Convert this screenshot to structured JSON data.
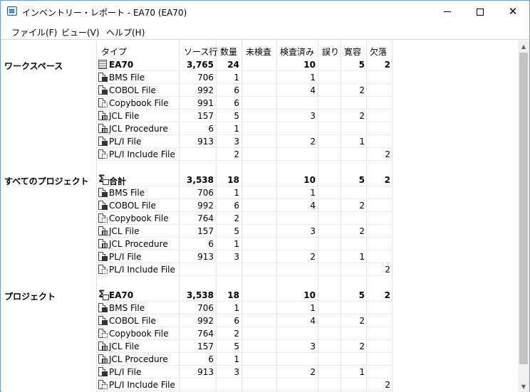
{
  "window": {
    "title": "インベントリー・レポート - EA70 (EA70)",
    "controls": {
      "minimize": "—",
      "maximize": "☐",
      "close": "✕"
    }
  },
  "menu": [
    {
      "label": "ファイル(F)"
    },
    {
      "label": "ビュー(V)"
    },
    {
      "label": "ヘルプ(H)"
    }
  ],
  "columns": {
    "type": "タイプ",
    "source_lines": "ソース行",
    "count": "数量",
    "unchecked": "未検査",
    "checked": "検査済み",
    "errors": "誤り",
    "tolerated": "寛容",
    "missing": "欠落"
  },
  "sections": [
    {
      "label": "ワークスペース",
      "summary": {
        "icon": "workspace-icon",
        "type": "EA70",
        "source_lines": "3,765",
        "count": "24",
        "unchecked": "",
        "checked": "10",
        "errors": "",
        "tolerated": "5",
        "missing": "2"
      },
      "rows": [
        {
          "icon": "bms-file-icon",
          "type": "BMS File",
          "source_lines": "706",
          "count": "1",
          "unchecked": "",
          "checked": "1",
          "errors": "",
          "tolerated": "",
          "missing": ""
        },
        {
          "icon": "cobol-file-icon",
          "type": "COBOL File",
          "source_lines": "992",
          "count": "6",
          "unchecked": "",
          "checked": "4",
          "errors": "",
          "tolerated": "2",
          "missing": ""
        },
        {
          "icon": "copybook-file-icon",
          "type": "Copybook File",
          "source_lines": "991",
          "count": "6",
          "unchecked": "",
          "checked": "",
          "errors": "",
          "tolerated": "",
          "missing": ""
        },
        {
          "icon": "jcl-file-icon",
          "type": "JCL File",
          "source_lines": "157",
          "count": "5",
          "unchecked": "",
          "checked": "3",
          "errors": "",
          "tolerated": "2",
          "missing": ""
        },
        {
          "icon": "jcl-procedure-icon",
          "type": "JCL Procedure",
          "source_lines": "6",
          "count": "1",
          "unchecked": "",
          "checked": "",
          "errors": "",
          "tolerated": "",
          "missing": ""
        },
        {
          "icon": "pli-file-icon",
          "type": "PL/I File",
          "source_lines": "913",
          "count": "3",
          "unchecked": "",
          "checked": "2",
          "errors": "",
          "tolerated": "1",
          "missing": ""
        },
        {
          "icon": "pli-include-file-icon",
          "type": "PL/I Include File",
          "source_lines": "",
          "count": "2",
          "unchecked": "",
          "checked": "",
          "errors": "",
          "tolerated": "",
          "missing": "2"
        }
      ]
    },
    {
      "label": "すべてのプロジェクト",
      "summary": {
        "icon": "total-icon",
        "type": "合計",
        "source_lines": "3,538",
        "count": "18",
        "unchecked": "",
        "checked": "10",
        "errors": "",
        "tolerated": "5",
        "missing": "2"
      },
      "rows": [
        {
          "icon": "bms-file-icon",
          "type": "BMS File",
          "source_lines": "706",
          "count": "1",
          "unchecked": "",
          "checked": "1",
          "errors": "",
          "tolerated": "",
          "missing": ""
        },
        {
          "icon": "cobol-file-icon",
          "type": "COBOL File",
          "source_lines": "992",
          "count": "6",
          "unchecked": "",
          "checked": "4",
          "errors": "",
          "tolerated": "2",
          "missing": ""
        },
        {
          "icon": "copybook-file-icon",
          "type": "Copybook File",
          "source_lines": "764",
          "count": "2",
          "unchecked": "",
          "checked": "",
          "errors": "",
          "tolerated": "",
          "missing": ""
        },
        {
          "icon": "jcl-file-icon",
          "type": "JCL File",
          "source_lines": "157",
          "count": "5",
          "unchecked": "",
          "checked": "3",
          "errors": "",
          "tolerated": "2",
          "missing": ""
        },
        {
          "icon": "jcl-procedure-icon",
          "type": "JCL Procedure",
          "source_lines": "6",
          "count": "1",
          "unchecked": "",
          "checked": "",
          "errors": "",
          "tolerated": "",
          "missing": ""
        },
        {
          "icon": "pli-file-icon",
          "type": "PL/I File",
          "source_lines": "913",
          "count": "3",
          "unchecked": "",
          "checked": "2",
          "errors": "",
          "tolerated": "1",
          "missing": ""
        },
        {
          "icon": "pli-include-file-icon",
          "type": "PL/I Include File",
          "source_lines": "",
          "count": "",
          "unchecked": "",
          "checked": "",
          "errors": "",
          "tolerated": "",
          "missing": "2"
        }
      ]
    },
    {
      "label": "プロジェクト",
      "summary": {
        "icon": "project-icon",
        "type": "EA70",
        "source_lines": "3,538",
        "count": "18",
        "unchecked": "",
        "checked": "10",
        "errors": "",
        "tolerated": "5",
        "missing": "2"
      },
      "rows": [
        {
          "icon": "bms-file-icon",
          "type": "BMS File",
          "source_lines": "706",
          "count": "1",
          "unchecked": "",
          "checked": "1",
          "errors": "",
          "tolerated": "",
          "missing": ""
        },
        {
          "icon": "cobol-file-icon",
          "type": "COBOL File",
          "source_lines": "992",
          "count": "6",
          "unchecked": "",
          "checked": "4",
          "errors": "",
          "tolerated": "2",
          "missing": ""
        },
        {
          "icon": "copybook-file-icon",
          "type": "Copybook File",
          "source_lines": "764",
          "count": "2",
          "unchecked": "",
          "checked": "",
          "errors": "",
          "tolerated": "",
          "missing": ""
        },
        {
          "icon": "jcl-file-icon",
          "type": "JCL File",
          "source_lines": "157",
          "count": "5",
          "unchecked": "",
          "checked": "3",
          "errors": "",
          "tolerated": "2",
          "missing": ""
        },
        {
          "icon": "jcl-procedure-icon",
          "type": "JCL Procedure",
          "source_lines": "6",
          "count": "1",
          "unchecked": "",
          "checked": "",
          "errors": "",
          "tolerated": "",
          "missing": ""
        },
        {
          "icon": "pli-file-icon",
          "type": "PL/I File",
          "source_lines": "913",
          "count": "3",
          "unchecked": "",
          "checked": "2",
          "errors": "",
          "tolerated": "1",
          "missing": ""
        },
        {
          "icon": "pli-include-file-icon",
          "type": "PL/I Include File",
          "source_lines": "",
          "count": "",
          "unchecked": "",
          "checked": "",
          "errors": "",
          "tolerated": "",
          "missing": "2"
        }
      ]
    }
  ],
  "scrollbar": {
    "up": "▲",
    "down": "▼"
  }
}
